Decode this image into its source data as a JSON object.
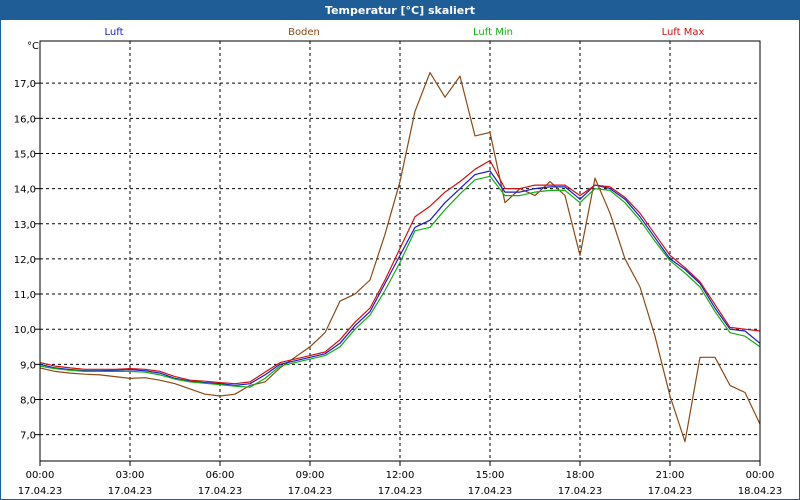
{
  "window": {
    "title": "Temperatur [°C] skaliert"
  },
  "chart_data": {
    "type": "line",
    "ylabel": "°C",
    "ylim": [
      6.25,
      18.2
    ],
    "yticks": [
      7.0,
      8.0,
      9.0,
      10.0,
      11.0,
      12.0,
      13.0,
      14.0,
      15.0,
      16.0,
      17.0
    ],
    "ytick_labels": [
      "7,0",
      "8,0",
      "9,0",
      "10,0",
      "11,0",
      "12,0",
      "13,0",
      "14,0",
      "15,0",
      "16,0",
      "17,0"
    ],
    "xlim": [
      0,
      24
    ],
    "xticks": [
      {
        "hour": 0,
        "time": "00:00",
        "date": "17.04.23"
      },
      {
        "hour": 3,
        "time": "03:00",
        "date": "17.04.23"
      },
      {
        "hour": 6,
        "time": "06:00",
        "date": "17.04.23"
      },
      {
        "hour": 9,
        "time": "09:00",
        "date": "17.04.23"
      },
      {
        "hour": 12,
        "time": "12:00",
        "date": "17.04.23"
      },
      {
        "hour": 15,
        "time": "15:00",
        "date": "17.04.23"
      },
      {
        "hour": 18,
        "time": "18:00",
        "date": "17.04.23"
      },
      {
        "hour": 21,
        "time": "21:00",
        "date": "17.04.23"
      },
      {
        "hour": 24,
        "time": "00:00",
        "date": "18.04.23"
      }
    ],
    "grid": true,
    "legend_position": "top",
    "x": [
      0,
      0.5,
      1,
      1.5,
      2,
      2.5,
      3,
      3.5,
      4,
      4.5,
      5,
      5.5,
      6,
      6.5,
      7,
      7.5,
      8,
      8.5,
      9,
      9.5,
      10,
      10.5,
      11,
      11.5,
      12,
      12.5,
      13,
      13.5,
      14,
      14.5,
      15,
      15.5,
      16,
      16.5,
      17,
      17.5,
      18,
      18.5,
      19,
      19.5,
      20,
      20.5,
      21,
      21.5,
      22,
      22.5,
      23,
      23.5,
      24
    ],
    "series": [
      {
        "name": "Luft",
        "color": "#1a1ad0",
        "values": [
          9.0,
          8.9,
          8.85,
          8.82,
          8.82,
          8.83,
          8.85,
          8.82,
          8.75,
          8.6,
          8.52,
          8.48,
          8.45,
          8.4,
          8.45,
          8.7,
          9.0,
          9.1,
          9.2,
          9.3,
          9.6,
          10.1,
          10.5,
          11.3,
          12.1,
          12.9,
          13.1,
          13.6,
          14.0,
          14.4,
          14.5,
          13.9,
          13.9,
          14.0,
          14.05,
          14.05,
          13.7,
          14.1,
          14.0,
          13.7,
          13.2,
          12.6,
          12.0,
          11.7,
          11.3,
          10.6,
          10.0,
          9.95,
          9.6
        ]
      },
      {
        "name": "Boden",
        "color": "#8b4a14",
        "values": [
          8.9,
          8.8,
          8.75,
          8.72,
          8.7,
          8.65,
          8.6,
          8.62,
          8.55,
          8.45,
          8.3,
          8.15,
          8.1,
          8.15,
          8.4,
          8.5,
          8.9,
          9.2,
          9.5,
          9.9,
          10.8,
          11.0,
          11.4,
          12.7,
          14.2,
          16.2,
          17.3,
          16.6,
          17.2,
          15.5,
          15.6,
          13.6,
          14.0,
          13.8,
          14.2,
          13.8,
          12.1,
          14.3,
          13.3,
          12.0,
          11.2,
          9.8,
          8.1,
          6.8,
          9.2,
          9.2,
          8.4,
          8.2,
          7.3
        ]
      },
      {
        "name": "Luft Min",
        "color": "#10b010",
        "values": [
          8.95,
          8.88,
          8.83,
          8.8,
          8.8,
          8.8,
          8.8,
          8.78,
          8.7,
          8.58,
          8.5,
          8.46,
          8.42,
          8.38,
          8.35,
          8.6,
          8.95,
          9.05,
          9.15,
          9.25,
          9.5,
          10.0,
          10.4,
          11.1,
          11.9,
          12.8,
          12.9,
          13.4,
          13.85,
          14.25,
          14.35,
          13.8,
          13.8,
          13.9,
          13.95,
          13.95,
          13.6,
          14.0,
          13.95,
          13.6,
          13.1,
          12.5,
          11.95,
          11.6,
          11.2,
          10.5,
          9.9,
          9.8,
          9.5
        ]
      },
      {
        "name": "Luft Max",
        "color": "#d01010",
        "values": [
          9.05,
          8.95,
          8.9,
          8.86,
          8.86,
          8.86,
          8.88,
          8.86,
          8.8,
          8.65,
          8.55,
          8.52,
          8.48,
          8.45,
          8.5,
          8.78,
          9.05,
          9.15,
          9.25,
          9.35,
          9.7,
          10.2,
          10.6,
          11.4,
          12.3,
          13.2,
          13.5,
          13.9,
          14.2,
          14.55,
          14.8,
          14.0,
          14.0,
          14.1,
          14.1,
          14.1,
          13.8,
          14.1,
          14.05,
          13.75,
          13.3,
          12.7,
          12.1,
          11.75,
          11.35,
          10.7,
          10.05,
          10.0,
          9.95
        ]
      }
    ]
  }
}
